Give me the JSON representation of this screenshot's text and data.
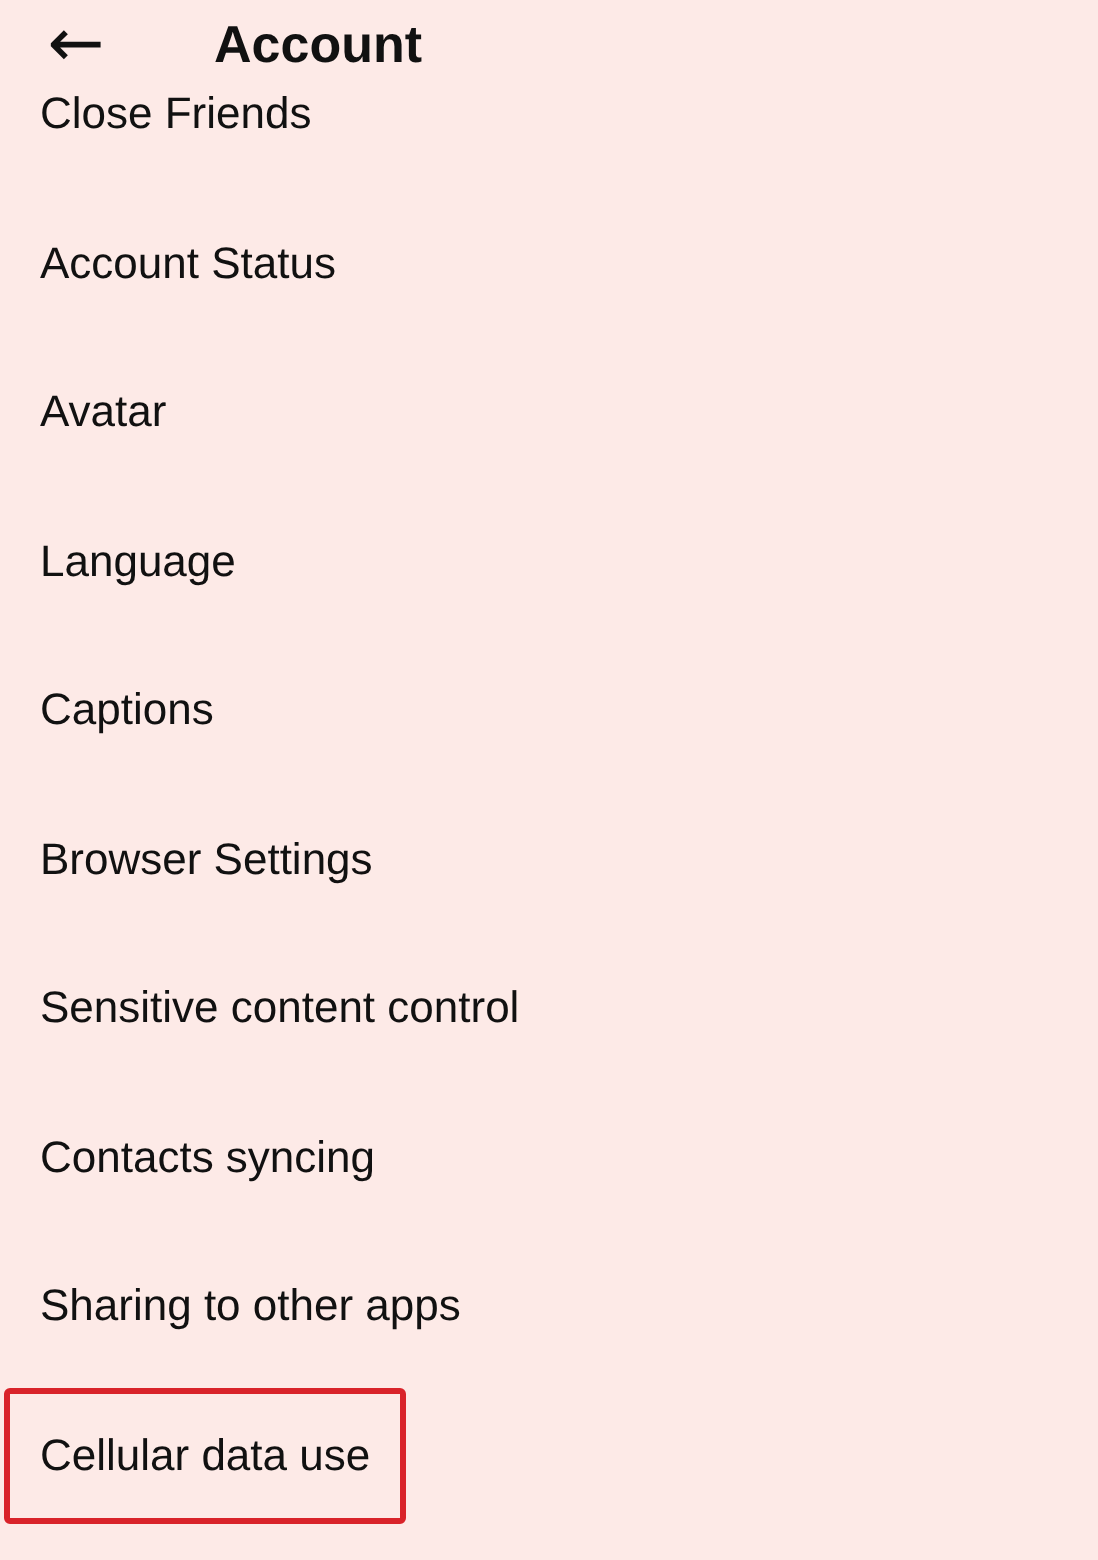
{
  "header": {
    "back_icon": "←",
    "title": "Account"
  },
  "items": [
    {
      "label": "Close Friends",
      "highlighted": false
    },
    {
      "label": "Account Status",
      "highlighted": false
    },
    {
      "label": "Avatar",
      "highlighted": false
    },
    {
      "label": "Language",
      "highlighted": false
    },
    {
      "label": "Captions",
      "highlighted": false
    },
    {
      "label": "Browser Settings",
      "highlighted": false
    },
    {
      "label": "Sensitive content control",
      "highlighted": false
    },
    {
      "label": "Contacts syncing",
      "highlighted": false
    },
    {
      "label": "Sharing to other apps",
      "highlighted": false
    },
    {
      "label": "Cellular data use",
      "highlighted": true
    }
  ]
}
